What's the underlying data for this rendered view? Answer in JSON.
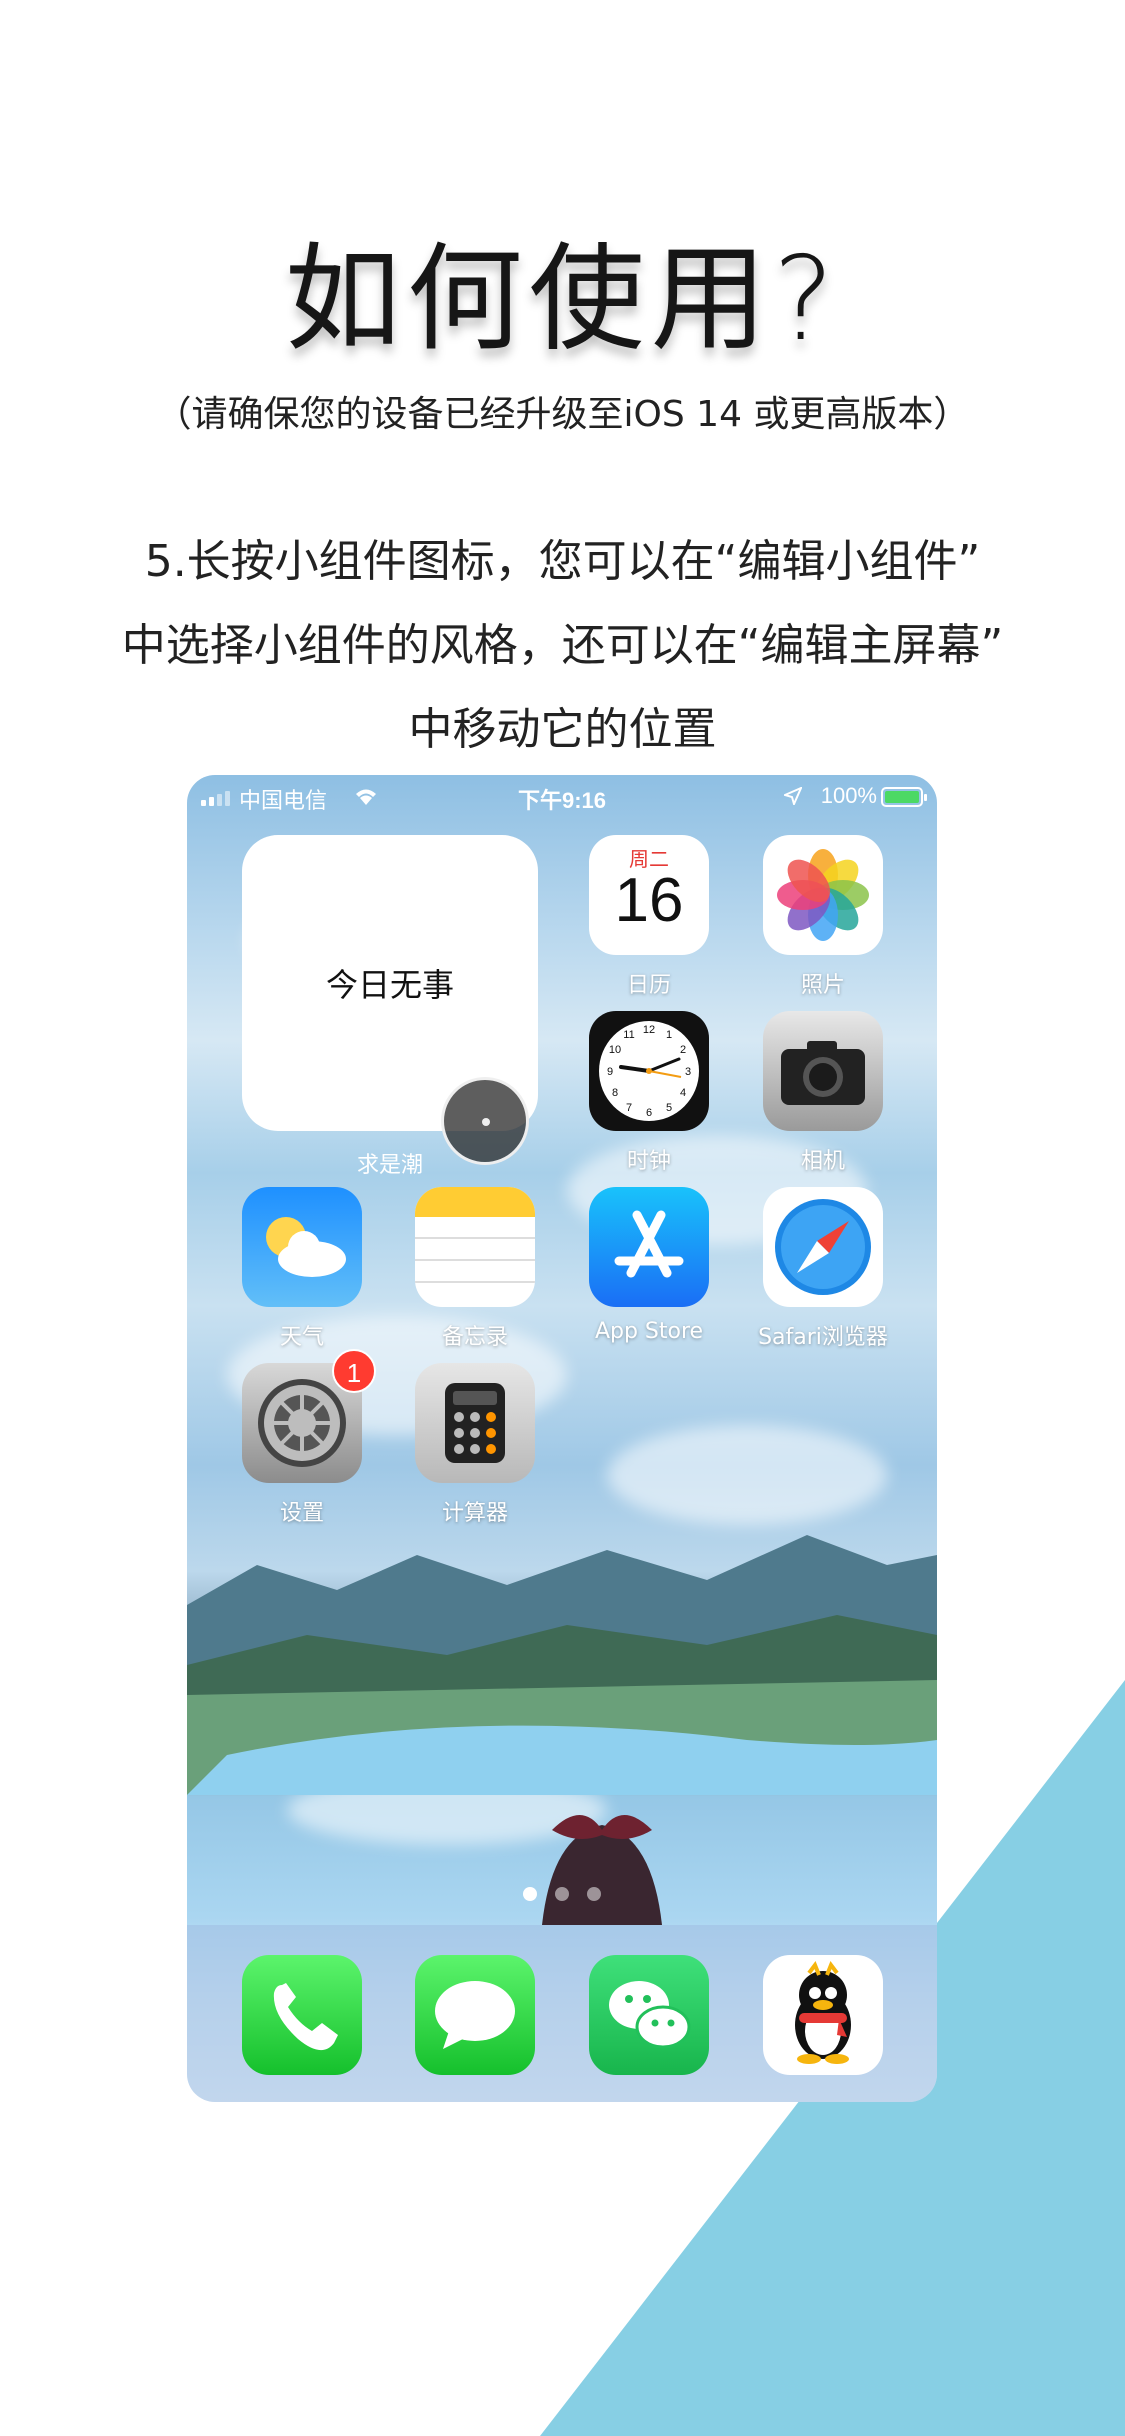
{
  "colors": {
    "accent_diagonal": "#87cfe4",
    "badge": "#ff3b30"
  },
  "header": {
    "title": "如何使用?",
    "subtitle": "（请确保您的设备已经升级至iOS 14 或更高版本）",
    "instruction_lines": [
      "5.长按小组件图标，您可以在“编辑小组件”",
      "中选择小组件的风格，还可以在“编辑主屏幕”",
      "中移动它的位置"
    ]
  },
  "phone": {
    "status_bar": {
      "carrier": "中国电信",
      "time": "下午9:16",
      "battery": "100%"
    },
    "widget": {
      "text": "今日无事",
      "label": "求是潮"
    },
    "calendar": {
      "weekday": "周二",
      "day": "16"
    },
    "apps": {
      "calendar": "日历",
      "photos": "照片",
      "clock": "时钟",
      "camera": "相机",
      "weather": "天气",
      "notes": "备忘录",
      "appstore": "App Store",
      "safari": "Safari浏览器",
      "settings": "设置",
      "calculator": "计算器"
    },
    "settings_badge": "1",
    "dock": [
      "phone-icon",
      "messages-icon",
      "wechat-icon",
      "qq-icon"
    ]
  }
}
